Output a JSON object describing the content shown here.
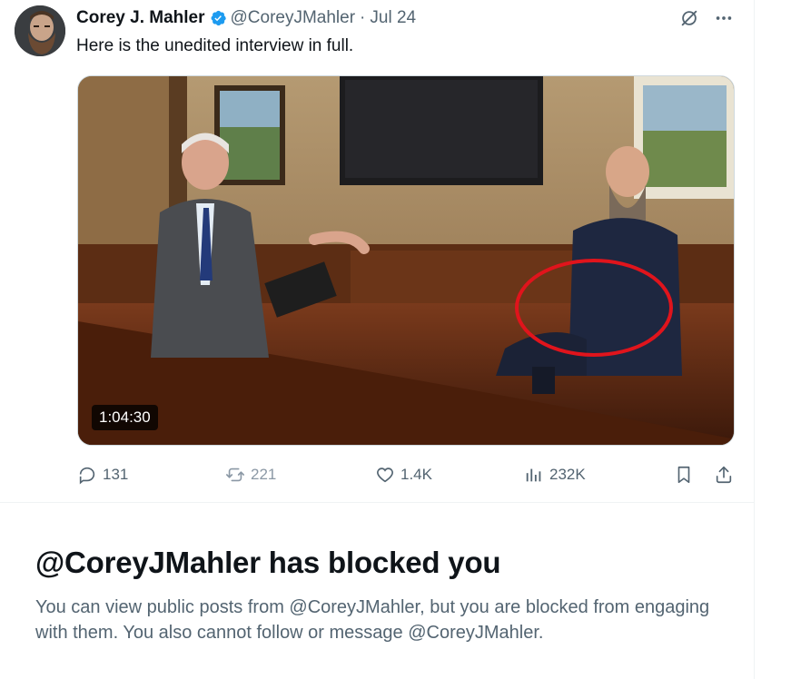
{
  "tweet": {
    "author_name": "Corey J. Mahler",
    "handle": "@CoreyJMahler",
    "separator": "·",
    "date": "Jul 24",
    "text": "Here is the unedited interview in full.",
    "verified": true,
    "media": {
      "type": "video",
      "duration": "1:04:30"
    },
    "actions": {
      "replies": "131",
      "reposts": "221",
      "likes": "1.4K",
      "views": "232K"
    },
    "icons": {
      "verified": "verified-badge-icon",
      "grok": "grok-icon",
      "more": "more-icon",
      "reply": "reply-icon",
      "repost": "repost-icon",
      "like": "like-icon",
      "views": "views-icon",
      "bookmark": "bookmark-icon",
      "share": "share-icon"
    }
  },
  "blocked": {
    "title": "@CoreyJMahler has blocked you",
    "body": "You can view public posts from @CoreyJMahler, but you are blocked from engaging with them. You also cannot follow or message @CoreyJMahler."
  },
  "colors": {
    "text_primary": "#0f1419",
    "text_secondary": "#536471",
    "verified_blue": "#1d9bf0",
    "annotation_circle": "#e0141c"
  }
}
